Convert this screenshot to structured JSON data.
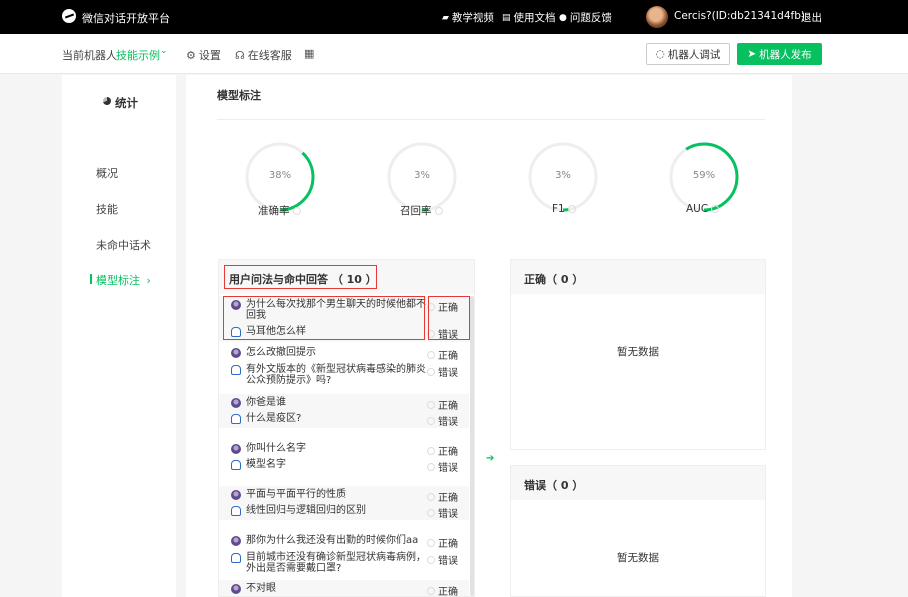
{
  "topbar": {
    "app_title": "微信对话开放平台",
    "nav": [
      "教学视频",
      "使用文档",
      "问题反馈"
    ],
    "user": "Cercis?(ID:db21341d4fb)",
    "logout": "退出"
  },
  "subbar": {
    "robot_label": "当前机器人",
    "robot_name": "技能示例",
    "settings": "设置",
    "support": "在线客服",
    "test_button": "机器人调试",
    "publish_button": "机器人发布"
  },
  "sidebar": {
    "title": "统计",
    "items": [
      "概况",
      "技能",
      "未命中话术",
      "模型标注"
    ],
    "active_arrow": "›"
  },
  "main": {
    "title": "模型标注",
    "metrics": [
      {
        "label": "准确率",
        "value": "38%",
        "fraction": 0.38
      },
      {
        "label": "召回率",
        "value": "3%",
        "fraction": 0.03
      },
      {
        "label": "F1",
        "value": "3%",
        "fraction": 0.03
      },
      {
        "label": "AUC",
        "value": "59%",
        "fraction": 0.59
      }
    ],
    "list_title": "用户问法与命中回答 （ 10 ）",
    "correct_label": "正确",
    "wrong_label": "错误",
    "pairs": [
      {
        "question": "为什么每次找那个男生聊天的时候他都不回我",
        "answer": "马耳他怎么样"
      },
      {
        "question": "怎么改撤回提示",
        "answer": "有外文版本的《新型冠状病毒感染的肺炎公众预防提示》吗?"
      },
      {
        "question": "你爸是谁",
        "answer": "什么是疫区?"
      },
      {
        "question": "你叫什么名字",
        "answer": "模型名字"
      },
      {
        "question": "平面与平面平行的性质",
        "answer": "线性回归与逻辑回归的区别"
      },
      {
        "question": "那你为什么我还没有出勤的时候你们aa",
        "answer": "目前城市还没有确诊新型冠状病毒病例，外出是否需要戴口罩?"
      },
      {
        "question": "不对眼",
        "answer": ""
      }
    ],
    "correct_panel": {
      "title": "正确（ 0 ）",
      "empty": "暂无数据"
    },
    "wrong_panel": {
      "title": "错误（ 0 ）",
      "empty": "暂无数据"
    }
  },
  "colors": {
    "accent": "#07c160",
    "highlight": "#e53935"
  }
}
